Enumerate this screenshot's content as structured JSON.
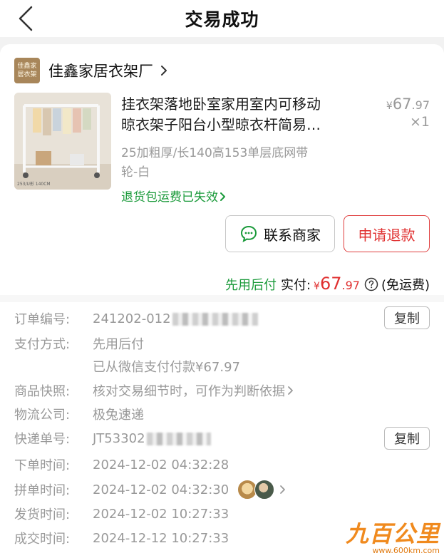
{
  "navbar": {
    "title": "交易成功"
  },
  "shop": {
    "logo_text": "佳鑫家居衣架",
    "name": "佳鑫家居衣架厂"
  },
  "product": {
    "title_line1": "挂衣架落地卧室家用室内可移动",
    "title_line2": "晾衣架子阳台小型晾衣杆简易…",
    "price_currency": "¥",
    "price_int": "67",
    "price_dec": ".97",
    "quantity": "×1",
    "spec_line1": "25加粗厚/长140高153单层底网带",
    "spec_line2": "轮-白",
    "return_notice": "退货包运费已失效",
    "image_caption": "253/U形 140CM"
  },
  "actions": {
    "contact_label": "联系商家",
    "refund_label": "申请退款"
  },
  "payment_summary": {
    "pay_later": "先用后付",
    "paid_label": "实付:",
    "currency": "¥",
    "amount_int": "67",
    "amount_dec": ".97",
    "shipping": "(免运费)"
  },
  "order_info": {
    "order_no": {
      "label": "订单编号:",
      "value": "241202-012",
      "copy": "复制"
    },
    "pay_method": {
      "label": "支付方式:",
      "value": "先用后付",
      "detail": "已从微信支付付款¥67.97"
    },
    "snapshot": {
      "label": "商品快照:",
      "value": "核对交易细节时，可作为判断依据"
    },
    "logistics": {
      "label": "物流公司:",
      "value": "极兔速递"
    },
    "tracking_no": {
      "label": "快递单号:",
      "value": "JT53302",
      "copy": "复制"
    },
    "order_time": {
      "label": "下单时间:",
      "value": "2024-12-02 04:32:28"
    },
    "group_time": {
      "label": "拼单时间:",
      "value": "2024-12-02 04:32:30"
    },
    "ship_time": {
      "label": "发货时间:",
      "value": "2024-12-02 10:27:33"
    },
    "deal_time": {
      "label": "成交时间:",
      "value": "2024-12-12 10:27:33"
    }
  },
  "watermark": {
    "main": "九百公里",
    "sub": "www.600km.com"
  },
  "colors": {
    "accent_red": "#e03030",
    "accent_green": "#1a9a3a",
    "muted": "#999999"
  },
  "icons": [
    "chevron-left-icon",
    "chevron-right-icon",
    "chat-bubble-icon",
    "question-circle-icon"
  ]
}
